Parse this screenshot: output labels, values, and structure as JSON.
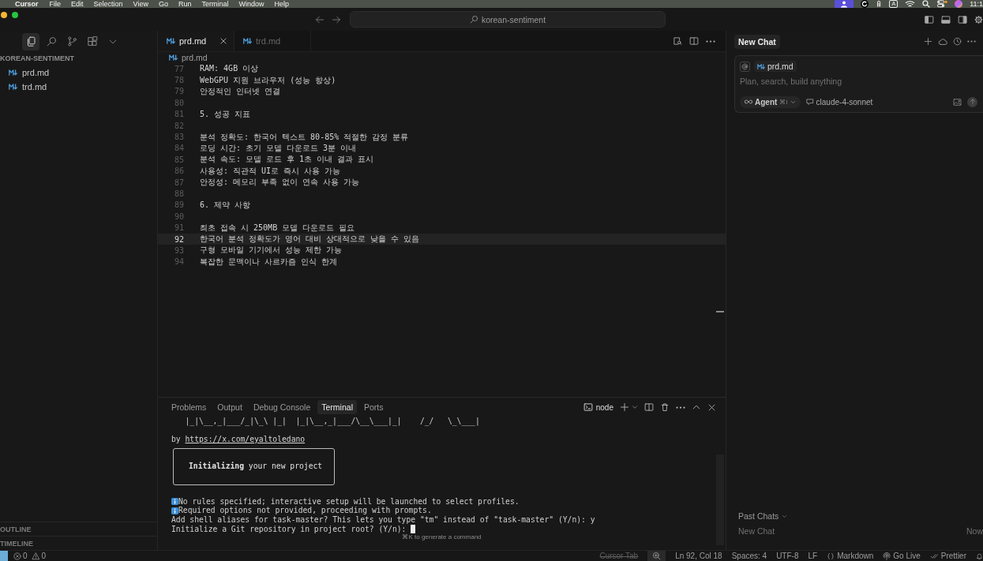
{
  "menubar": {
    "app": "Cursor",
    "menus": [
      "File",
      "Edit",
      "Selection",
      "View",
      "Go",
      "Run",
      "Terminal",
      "Window",
      "Help"
    ],
    "input_source": "A",
    "clock": "11:1"
  },
  "titlebar": {
    "workspace": "korean-sentiment"
  },
  "sidebar": {
    "views": [
      {
        "kind": "files",
        "selected": true
      },
      {
        "kind": "search",
        "selected": false
      },
      {
        "kind": "source-control",
        "selected": false
      },
      {
        "kind": "extensions",
        "selected": false
      },
      {
        "kind": "more",
        "selected": false
      }
    ],
    "title": "KOREAN-SENTIMENT",
    "files": [
      {
        "name": "prd.md",
        "selected": false
      },
      {
        "name": "trd.md",
        "selected": false
      }
    ],
    "sections": [
      "OUTLINE",
      "TIMELINE"
    ]
  },
  "editor": {
    "tabs": [
      {
        "label": "prd.md",
        "selected": true
      },
      {
        "label": "trd.md",
        "selected": false
      }
    ],
    "breadcrumb": "prd.md",
    "lines": [
      {
        "number": "77",
        "text": "RAM: 4GB 이상",
        "current": false
      },
      {
        "number": "78",
        "text": "WebGPU 지원 브라우저 (성능 향상)",
        "current": false
      },
      {
        "number": "79",
        "text": "안정적인 인터넷 연결",
        "current": false
      },
      {
        "number": "80",
        "current": false
      },
      {
        "number": "81",
        "text": "5. 성공 지표",
        "current": false
      },
      {
        "number": "82",
        "current": false
      },
      {
        "number": "83",
        "text": "분석 정확도: 한국어 텍스트 80-85% 적절한 감정 분류",
        "current": false
      },
      {
        "number": "84",
        "text": "로딩 시간: 초기 모델 다운로드 3분 이내",
        "current": false
      },
      {
        "number": "85",
        "text": "분석 속도: 모델 로드 후 1초 이내 결과 표시",
        "current": false
      },
      {
        "number": "86",
        "text": "사용성: 직관적 UI로 즉시 사용 가능",
        "current": false
      },
      {
        "number": "87",
        "text": "안정성: 메모리 부족 없이 연속 사용 가능",
        "current": false
      },
      {
        "number": "88",
        "current": false
      },
      {
        "number": "89",
        "text": "6. 제약 사항",
        "current": false
      },
      {
        "number": "90",
        "current": false
      },
      {
        "number": "91",
        "text": "최초 접속 시 250MB 모델 다운로드 필요",
        "current": false
      },
      {
        "number": "92",
        "text": "한국어 분석 정확도가 영어 대비 상대적으로 낮을 수 있음",
        "current": true
      },
      {
        "number": "93",
        "text": "구형 모바일 기기에서 성능 제한 가능",
        "current": false
      },
      {
        "number": "94",
        "text": "복잡한 문맥이나 사르카즘 인식 한계",
        "current": false
      }
    ]
  },
  "panel": {
    "tabs": [
      {
        "label": "Problems",
        "selected": false
      },
      {
        "label": "Output",
        "selected": false
      },
      {
        "label": "Debug Console",
        "selected": false
      },
      {
        "label": "Terminal",
        "selected": true
      },
      {
        "label": "Ports",
        "selected": false
      }
    ],
    "terminal_name": "node",
    "terminal": [
      {
        "kind": "art",
        "text": "|_|\\__,_|___/_|\\_\\ |_|  |_|\\__,_|___/\\__\\___|_|    /_/   \\_\\___|"
      },
      {
        "kind": "link",
        "prefix": "by",
        "url": "https://x.com/eyaltoledano"
      },
      {
        "kind": "box",
        "text": "**Initializing** your new project"
      },
      {
        "kind": "info",
        "text": "No rules specified; interactive setup will be launched to select profiles."
      },
      {
        "kind": "info",
        "text": "Required options not provided, proceeding with prompts."
      },
      {
        "kind": "text",
        "text": "Add shell aliases for task-master? This lets you type \"tm\" instead of \"task-master\" (Y/n): y"
      },
      {
        "kind": "prompt",
        "text": "Initialize a Git repository in project root? (Y/n):"
      }
    ],
    "hint": "⌘K to generate a command"
  },
  "chat": {
    "tab": "New Chat",
    "context_file": "prd.md",
    "placeholder": "Plan, search, build anything",
    "mode": "Agent",
    "mode_shortcut": "⌘I",
    "model": "claude-4-sonnet",
    "history_title": "Past Chats",
    "history": [
      {
        "title": "New Chat",
        "time": "Now"
      }
    ]
  },
  "status_bar": {
    "problems": [
      {
        "kind": "error",
        "count": "0"
      },
      {
        "kind": "warning",
        "count": "0"
      }
    ],
    "items": [
      {
        "kind": "text",
        "text": "Cursor Tab",
        "disabled": true
      },
      {
        "kind": "zoom",
        "disabled": false
      },
      {
        "kind": "text",
        "text": "Ln 92, Col 18",
        "disabled": false
      },
      {
        "kind": "text",
        "text": "Spaces: 4",
        "disabled": false
      },
      {
        "kind": "text",
        "text": "UTF-8",
        "disabled": false
      },
      {
        "kind": "text",
        "text": "LF",
        "disabled": false
      },
      {
        "kind": "braces",
        "text": "Markdown",
        "disabled": false
      },
      {
        "kind": "broadcast",
        "text": "Go Live",
        "disabled": false
      },
      {
        "kind": "double-check",
        "text": "Prettier",
        "disabled": false
      },
      {
        "kind": "bell",
        "disabled": false
      }
    ]
  }
}
